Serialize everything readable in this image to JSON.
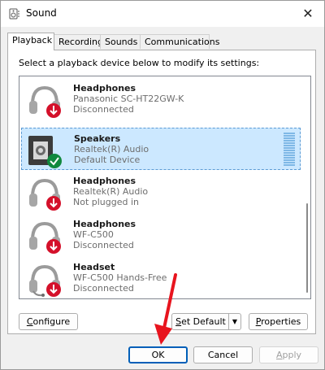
{
  "window": {
    "title": "Sound"
  },
  "tabs": [
    {
      "label": "Playback"
    },
    {
      "label": "Recording"
    },
    {
      "label": "Sounds"
    },
    {
      "label": "Communications"
    }
  ],
  "instruction": "Select a playback device below to modify its settings:",
  "devices": [
    {
      "name": "Headphones",
      "model": "Panasonic SC-HT22GW-K",
      "status": "Disconnected",
      "icon": "headphones-disconnected-icon"
    },
    {
      "name": "Speakers",
      "model": "Realtek(R) Audio",
      "status": "Default Device",
      "icon": "speaker-default-icon",
      "selected": true
    },
    {
      "name": "Headphones",
      "model": "Realtek(R) Audio",
      "status": "Not plugged in",
      "icon": "headphones-unplugged-icon"
    },
    {
      "name": "Headphones",
      "model": "WF-C500",
      "status": "Disconnected",
      "icon": "headphones-disconnected-icon"
    },
    {
      "name": "Headset",
      "model": "WF-C500 Hands-Free",
      "status": "Disconnected",
      "icon": "headset-disconnected-icon"
    }
  ],
  "buttons": {
    "configure_c": "C",
    "configure_rest": "onfigure",
    "set_default_s": "S",
    "set_default_rest": "et Default",
    "properties_p": "P",
    "properties_rest": "roperties",
    "ok": "OK",
    "cancel": "Cancel",
    "apply_a": "A",
    "apply_rest": "pply"
  },
  "colors": {
    "accent": "#005fb8",
    "selection": "#cce8ff",
    "annotation_arrow": "#e8141e"
  }
}
